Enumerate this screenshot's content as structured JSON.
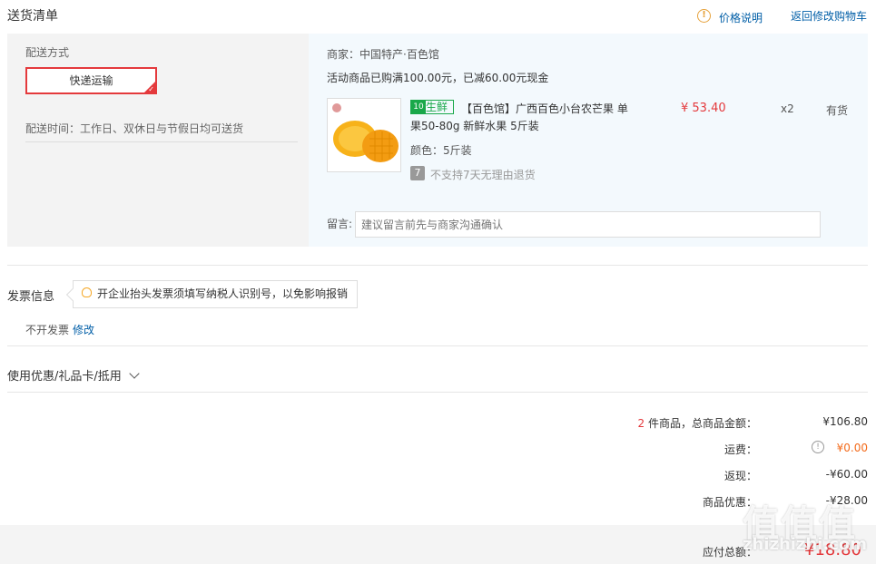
{
  "header": {
    "title": "送货清单",
    "price_info_label": "价格说明",
    "price_info_icon": "!",
    "back_to_cart_label": "返回修改购物车"
  },
  "shipping": {
    "method_label": "配送方式",
    "method_value": "快递运输",
    "time_text": "配送时间：工作日、双休日与节假日均可送货"
  },
  "order": {
    "merchant": "商家：中国特产·百色馆",
    "promo": "活动商品已购满100.00元，已减60.00元现金",
    "product": {
      "badge_icon": "10",
      "badge_text": "生鲜",
      "name_line1": "【百色馆】广西百色小台农芒果 单",
      "name_line2": "果50-80g 新鲜水果 5斤装",
      "color": "颜色：5斤装",
      "price": "¥ 53.40",
      "quantity": "x2",
      "stock": "有货",
      "return_icon": "7",
      "return_policy": "不支持7天无理由退货"
    },
    "message_label": "留言:",
    "message_placeholder": "建议留言前先与商家沟通确认"
  },
  "invoice": {
    "title": "发票信息",
    "tip": "开企业抬头发票须填写纳税人识别号，以免影响报销",
    "status": "不开发票",
    "modify_label": "修改"
  },
  "discounts": {
    "label": "使用优惠/礼品卡/抵用",
    "chevron": "⌵"
  },
  "summary": {
    "count": "2",
    "count_suffix": " 件商品，总商品金额：",
    "goods_total": "¥106.80",
    "shipping_label": "运费：",
    "shipping_icon": "!",
    "shipping_value": "¥0.00",
    "rebate_label": "返现：",
    "rebate_value": "-¥60.00",
    "coupon_label": "商品优惠：",
    "coupon_value": "-¥28.00",
    "payable_label": "应付总额：",
    "payable_value": "¥18.80"
  },
  "watermark": {
    "logo": "值值值",
    "url": "zhizhizhi.com"
  },
  "colors": {
    "accent_red": "#e4393c",
    "link_blue": "#005ea7",
    "fresh_green": "#1aa84a",
    "shipping_orange": "#e4393c"
  }
}
